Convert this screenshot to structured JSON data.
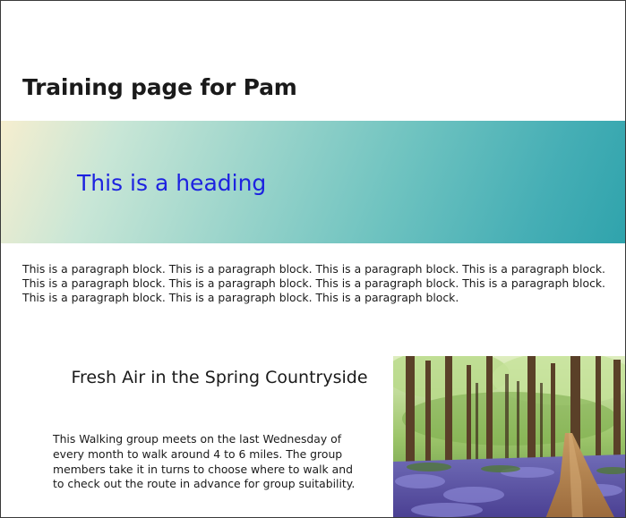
{
  "page": {
    "title": "Training page for Pam"
  },
  "cover": {
    "heading": "This is a heading",
    "heading_color": "#1d22e0"
  },
  "paragraph": {
    "text": "This is a paragraph block.  This is a paragraph block.  This is a paragraph block.  This is a paragraph block.  This is a paragraph block.  This is a paragraph block.  This is a paragraph block.  This is a paragraph block.  This is a paragraph block.  This is a paragraph block.  This is a paragraph block."
  },
  "section": {
    "heading": "Fresh Air in the Spring Countryside",
    "text": "This Walking group meets on the last Wednesday of every month to walk around 4 to 6 miles.  The group members take it in turns to choose where to walk and to check out the route in advance for group suitability."
  }
}
